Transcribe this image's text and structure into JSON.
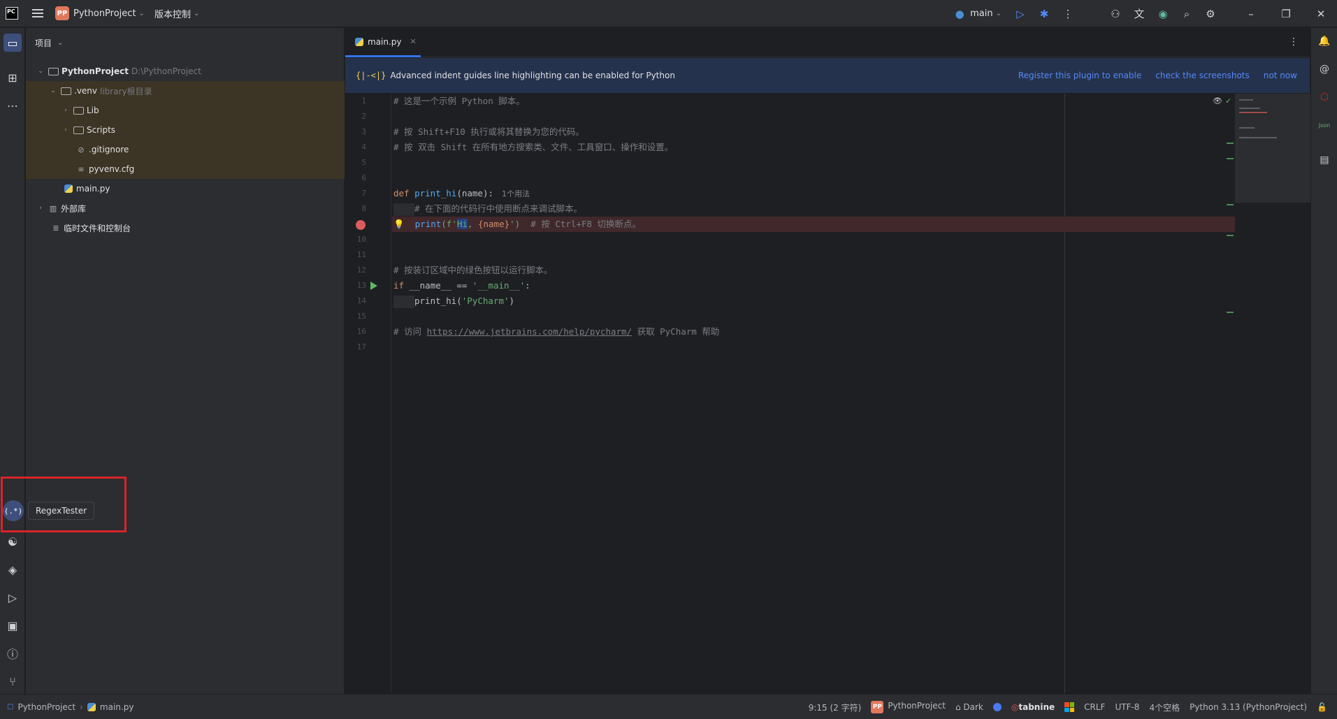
{
  "titlebar": {
    "app_logo": "PC",
    "project_badge": "PP",
    "project_name": "PythonProject",
    "vcs_label": "版本控制",
    "branch": "main"
  },
  "project_panel": {
    "header": "项目",
    "tree": [
      {
        "name": "PythonProject",
        "extra": "D:\\PythonProject"
      },
      {
        "name": ".venv",
        "extra": "library根目录"
      },
      {
        "name": "Lib"
      },
      {
        "name": "Scripts"
      },
      {
        "name": ".gitignore"
      },
      {
        "name": "pyvenv.cfg"
      },
      {
        "name": "main.py"
      },
      {
        "name": "外部库"
      },
      {
        "name": "临时文件和控制台"
      }
    ]
  },
  "tooltip": {
    "button_glyph": "(.*)",
    "text": "RegexTester"
  },
  "editor": {
    "tab": "main.py",
    "banner": {
      "icon": "{|-<|}",
      "text": "Advanced indent guides line highlighting can be enabled for Python",
      "link1": "Register this plugin to enable",
      "link2": "check the screenshots",
      "link3": "not now"
    },
    "line_numbers": [
      "1",
      "2",
      "3",
      "4",
      "5",
      "6",
      "7",
      "8",
      "9",
      "10",
      "11",
      "12",
      "13",
      "14",
      "15",
      "16",
      "17"
    ],
    "code": {
      "l1": "# 这是一个示例 Python 脚本。",
      "l3": "# 按 Shift+F10 执行或将其替换为您的代码。",
      "l4": "# 按 双击 Shift 在所有地方搜索类、文件、工具窗口、操作和设置。",
      "l7_kw": "def",
      "l7_fn": "print_hi",
      "l7_rest": "(name):",
      "l7_hint": "1个用法",
      "l8": "# 在下面的代码行中使用断点来调试脚本。",
      "l9_fn": "print",
      "l9_a": "(f'",
      "l9_sel": "Hi",
      "l9_b": ", ",
      "l9_fmt": "{name}",
      "l9_c": "')",
      "l9_cmt": "# 按 Ctrl+F8 切换断点。",
      "l12": "# 按装订区域中的绿色按钮以运行脚本。",
      "l13_kw": "if",
      "l13_rest": " __name__ == ",
      "l13_str": "'__main__'",
      "l13_end": ":",
      "l14_fn": "print_hi",
      "l14_a": "(",
      "l14_str": "'PyCharm'",
      "l14_b": ")",
      "l16_a": "# 访问 ",
      "l16_link": "https://www.jetbrains.com/help/pycharm/",
      "l16_b": " 获取 PyCharm 帮助"
    }
  },
  "statusbar": {
    "breadcrumb_project": "PythonProject",
    "breadcrumb_file": "main.py",
    "position": "9:15 (2 字符)",
    "project_badge": "PP",
    "project": "PythonProject",
    "theme": "Dark",
    "tabnine": "tabnine",
    "line_ending": "CRLF",
    "encoding": "UTF-8",
    "indent": "4个空格",
    "interpreter": "Python 3.13 (PythonProject)"
  }
}
